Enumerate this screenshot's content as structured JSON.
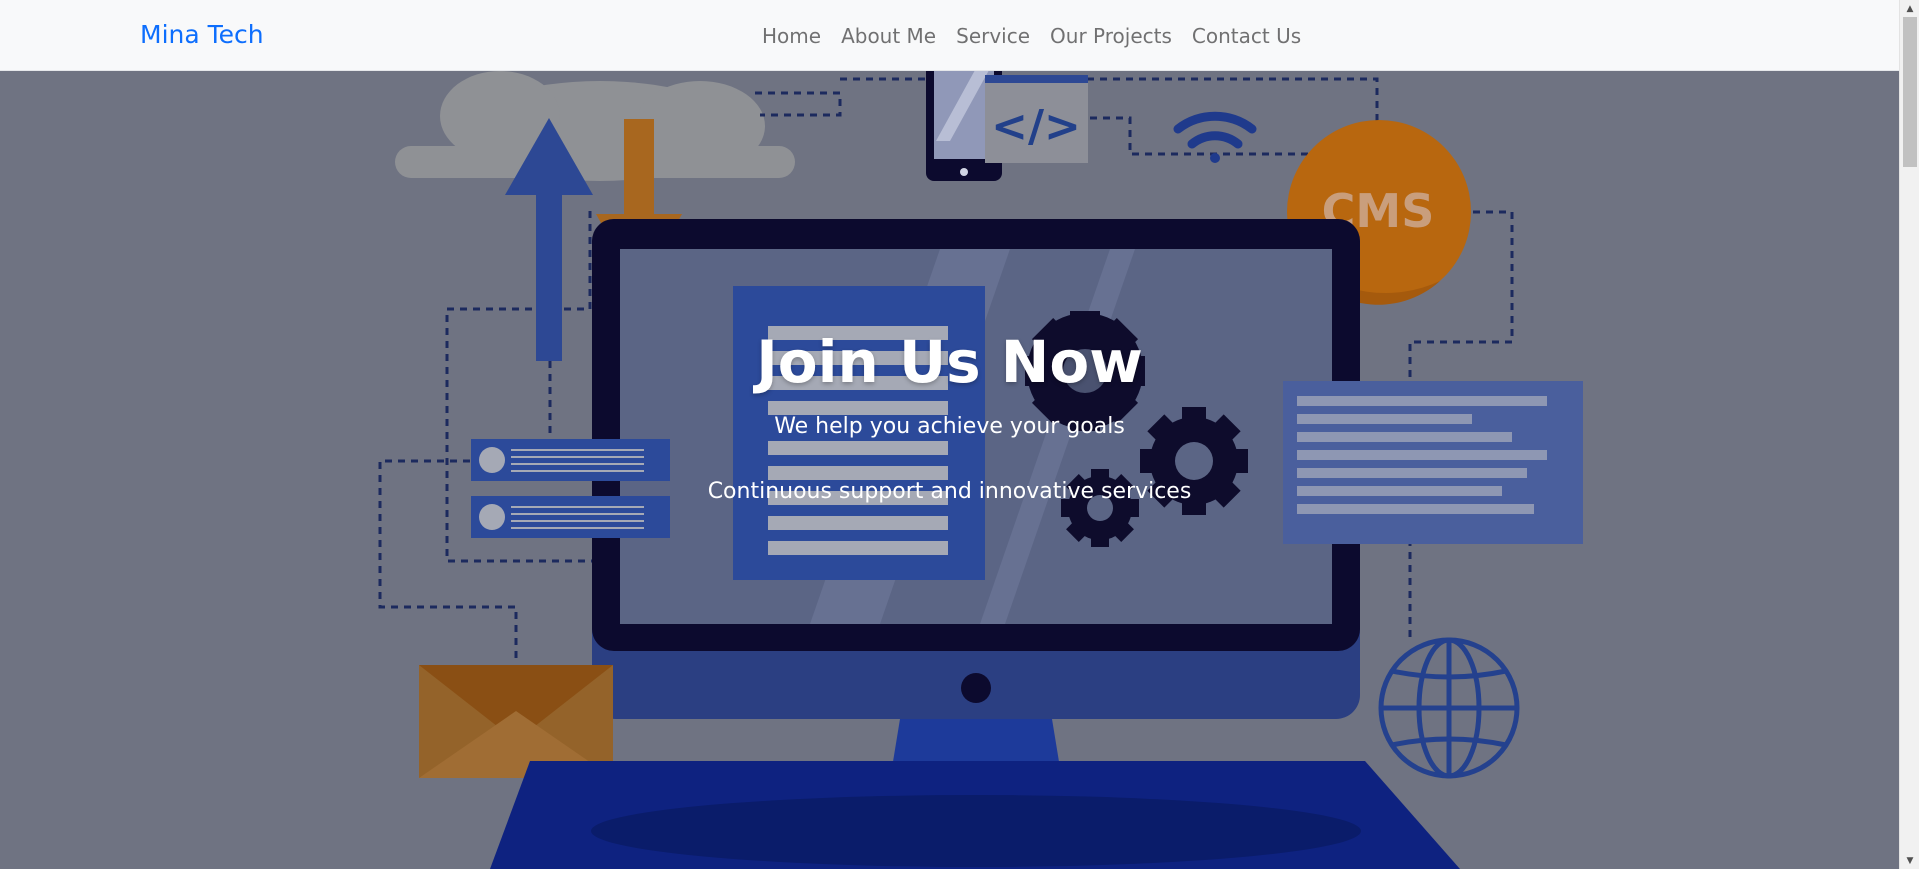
{
  "navbar": {
    "brand": "Mina Tech",
    "links": [
      {
        "label": "Home"
      },
      {
        "label": "About Me"
      },
      {
        "label": "Service"
      },
      {
        "label": "Our Projects"
      },
      {
        "label": "Contact Us"
      }
    ]
  },
  "hero": {
    "title": "Join Us Now",
    "subtitle": "We help you achieve your goals",
    "tagline": "Continuous support and innovative services",
    "illustration": {
      "badge_text": "CMS",
      "code_icon_text": "</>"
    }
  },
  "colors": {
    "brand": "#0d6efd",
    "navbar_bg": "#f8f9fa",
    "overlay": "#6f7382",
    "accent_orange": "#b86a1c",
    "accent_blue": "#22408a",
    "dark_navy": "#0c0a2e"
  }
}
